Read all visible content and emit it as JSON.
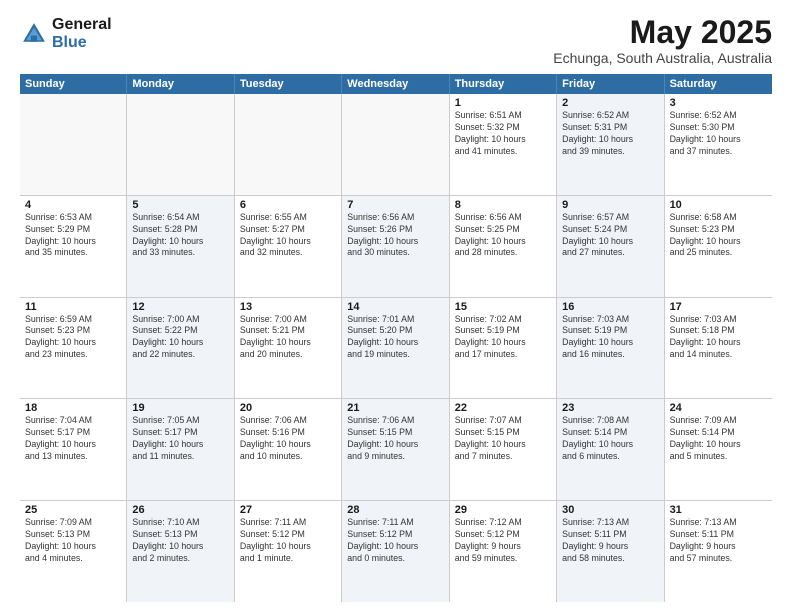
{
  "logo": {
    "general": "General",
    "blue": "Blue"
  },
  "title": "May 2025",
  "location": "Echunga, South Australia, Australia",
  "days_of_week": [
    "Sunday",
    "Monday",
    "Tuesday",
    "Wednesday",
    "Thursday",
    "Friday",
    "Saturday"
  ],
  "rows": [
    [
      {
        "day": "",
        "info": "",
        "empty": true
      },
      {
        "day": "",
        "info": "",
        "empty": true
      },
      {
        "day": "",
        "info": "",
        "empty": true
      },
      {
        "day": "",
        "info": "",
        "empty": true
      },
      {
        "day": "1",
        "info": "Sunrise: 6:51 AM\nSunset: 5:32 PM\nDaylight: 10 hours\nand 41 minutes.",
        "empty": false,
        "shaded": false
      },
      {
        "day": "2",
        "info": "Sunrise: 6:52 AM\nSunset: 5:31 PM\nDaylight: 10 hours\nand 39 minutes.",
        "empty": false,
        "shaded": true
      },
      {
        "day": "3",
        "info": "Sunrise: 6:52 AM\nSunset: 5:30 PM\nDaylight: 10 hours\nand 37 minutes.",
        "empty": false,
        "shaded": false
      }
    ],
    [
      {
        "day": "4",
        "info": "Sunrise: 6:53 AM\nSunset: 5:29 PM\nDaylight: 10 hours\nand 35 minutes.",
        "empty": false,
        "shaded": false
      },
      {
        "day": "5",
        "info": "Sunrise: 6:54 AM\nSunset: 5:28 PM\nDaylight: 10 hours\nand 33 minutes.",
        "empty": false,
        "shaded": true
      },
      {
        "day": "6",
        "info": "Sunrise: 6:55 AM\nSunset: 5:27 PM\nDaylight: 10 hours\nand 32 minutes.",
        "empty": false,
        "shaded": false
      },
      {
        "day": "7",
        "info": "Sunrise: 6:56 AM\nSunset: 5:26 PM\nDaylight: 10 hours\nand 30 minutes.",
        "empty": false,
        "shaded": true
      },
      {
        "day": "8",
        "info": "Sunrise: 6:56 AM\nSunset: 5:25 PM\nDaylight: 10 hours\nand 28 minutes.",
        "empty": false,
        "shaded": false
      },
      {
        "day": "9",
        "info": "Sunrise: 6:57 AM\nSunset: 5:24 PM\nDaylight: 10 hours\nand 27 minutes.",
        "empty": false,
        "shaded": true
      },
      {
        "day": "10",
        "info": "Sunrise: 6:58 AM\nSunset: 5:23 PM\nDaylight: 10 hours\nand 25 minutes.",
        "empty": false,
        "shaded": false
      }
    ],
    [
      {
        "day": "11",
        "info": "Sunrise: 6:59 AM\nSunset: 5:23 PM\nDaylight: 10 hours\nand 23 minutes.",
        "empty": false,
        "shaded": false
      },
      {
        "day": "12",
        "info": "Sunrise: 7:00 AM\nSunset: 5:22 PM\nDaylight: 10 hours\nand 22 minutes.",
        "empty": false,
        "shaded": true
      },
      {
        "day": "13",
        "info": "Sunrise: 7:00 AM\nSunset: 5:21 PM\nDaylight: 10 hours\nand 20 minutes.",
        "empty": false,
        "shaded": false
      },
      {
        "day": "14",
        "info": "Sunrise: 7:01 AM\nSunset: 5:20 PM\nDaylight: 10 hours\nand 19 minutes.",
        "empty": false,
        "shaded": true
      },
      {
        "day": "15",
        "info": "Sunrise: 7:02 AM\nSunset: 5:19 PM\nDaylight: 10 hours\nand 17 minutes.",
        "empty": false,
        "shaded": false
      },
      {
        "day": "16",
        "info": "Sunrise: 7:03 AM\nSunset: 5:19 PM\nDaylight: 10 hours\nand 16 minutes.",
        "empty": false,
        "shaded": true
      },
      {
        "day": "17",
        "info": "Sunrise: 7:03 AM\nSunset: 5:18 PM\nDaylight: 10 hours\nand 14 minutes.",
        "empty": false,
        "shaded": false
      }
    ],
    [
      {
        "day": "18",
        "info": "Sunrise: 7:04 AM\nSunset: 5:17 PM\nDaylight: 10 hours\nand 13 minutes.",
        "empty": false,
        "shaded": false
      },
      {
        "day": "19",
        "info": "Sunrise: 7:05 AM\nSunset: 5:17 PM\nDaylight: 10 hours\nand 11 minutes.",
        "empty": false,
        "shaded": true
      },
      {
        "day": "20",
        "info": "Sunrise: 7:06 AM\nSunset: 5:16 PM\nDaylight: 10 hours\nand 10 minutes.",
        "empty": false,
        "shaded": false
      },
      {
        "day": "21",
        "info": "Sunrise: 7:06 AM\nSunset: 5:15 PM\nDaylight: 10 hours\nand 9 minutes.",
        "empty": false,
        "shaded": true
      },
      {
        "day": "22",
        "info": "Sunrise: 7:07 AM\nSunset: 5:15 PM\nDaylight: 10 hours\nand 7 minutes.",
        "empty": false,
        "shaded": false
      },
      {
        "day": "23",
        "info": "Sunrise: 7:08 AM\nSunset: 5:14 PM\nDaylight: 10 hours\nand 6 minutes.",
        "empty": false,
        "shaded": true
      },
      {
        "day": "24",
        "info": "Sunrise: 7:09 AM\nSunset: 5:14 PM\nDaylight: 10 hours\nand 5 minutes.",
        "empty": false,
        "shaded": false
      }
    ],
    [
      {
        "day": "25",
        "info": "Sunrise: 7:09 AM\nSunset: 5:13 PM\nDaylight: 10 hours\nand 4 minutes.",
        "empty": false,
        "shaded": false
      },
      {
        "day": "26",
        "info": "Sunrise: 7:10 AM\nSunset: 5:13 PM\nDaylight: 10 hours\nand 2 minutes.",
        "empty": false,
        "shaded": true
      },
      {
        "day": "27",
        "info": "Sunrise: 7:11 AM\nSunset: 5:12 PM\nDaylight: 10 hours\nand 1 minute.",
        "empty": false,
        "shaded": false
      },
      {
        "day": "28",
        "info": "Sunrise: 7:11 AM\nSunset: 5:12 PM\nDaylight: 10 hours\nand 0 minutes.",
        "empty": false,
        "shaded": true
      },
      {
        "day": "29",
        "info": "Sunrise: 7:12 AM\nSunset: 5:12 PM\nDaylight: 9 hours\nand 59 minutes.",
        "empty": false,
        "shaded": false
      },
      {
        "day": "30",
        "info": "Sunrise: 7:13 AM\nSunset: 5:11 PM\nDaylight: 9 hours\nand 58 minutes.",
        "empty": false,
        "shaded": true
      },
      {
        "day": "31",
        "info": "Sunrise: 7:13 AM\nSunset: 5:11 PM\nDaylight: 9 hours\nand 57 minutes.",
        "empty": false,
        "shaded": false
      }
    ]
  ]
}
